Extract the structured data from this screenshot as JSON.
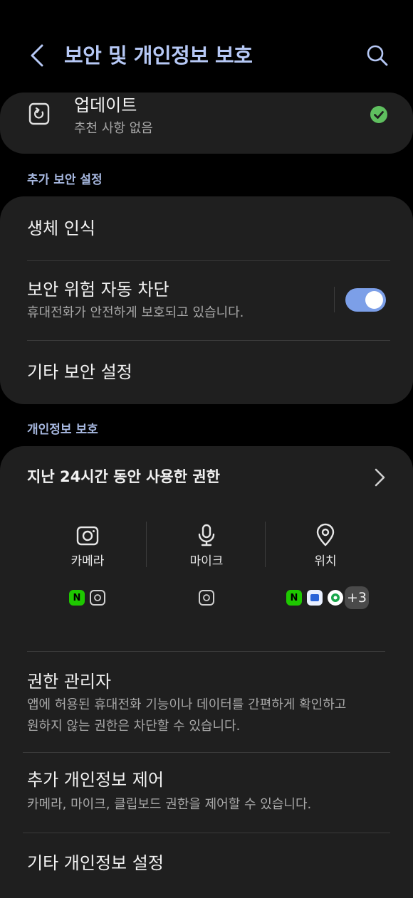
{
  "header": {
    "title": "보안 및 개인정보 보호",
    "back_icon": "chevron-left-icon",
    "search_icon": "search-icon"
  },
  "update": {
    "title": "업데이트",
    "subtitle": "추천 사항 없음",
    "status_color": "#5fbf5f"
  },
  "security_section": {
    "label": "추가 보안 설정",
    "items": [
      {
        "title": "생체 인식"
      },
      {
        "title": "보안 위험 자동 차단",
        "subtitle": "휴대전화가 안전하게 보호되고 있습니다.",
        "toggle_on": true
      },
      {
        "title": "기타 보안 설정"
      }
    ]
  },
  "privacy_section": {
    "label": "개인정보 보호",
    "permissions_card": {
      "title": "지난 24시간 동안 사용한 권한",
      "columns": [
        {
          "label": "카메라",
          "icon": "camera-icon",
          "apps": [
            "N",
            "camera"
          ]
        },
        {
          "label": "마이크",
          "icon": "microphone-icon",
          "apps": [
            "camera"
          ]
        },
        {
          "label": "위치",
          "icon": "location-pin-icon",
          "apps": [
            "N",
            "blue-app",
            "green-app"
          ],
          "more": "+3"
        }
      ]
    },
    "items": [
      {
        "title": "권한 관리자",
        "subtitle_line1": "앱에 허용된 휴대전화 기능이나 데이터를 간편하게 확인하고",
        "subtitle_line2": "원하지 않는 권한은 차단할 수 있습니다."
      },
      {
        "title": "추가 개인정보 제어",
        "subtitle": "카메라, 마이크, 클립보드 권한을 제어할 수 있습니다."
      },
      {
        "title": "기타 개인정보 설정"
      }
    ]
  },
  "colors": {
    "accent": "#b6c8f5",
    "toggle_on": "#7c9fe8",
    "card_bg": "#1f1f1f"
  }
}
